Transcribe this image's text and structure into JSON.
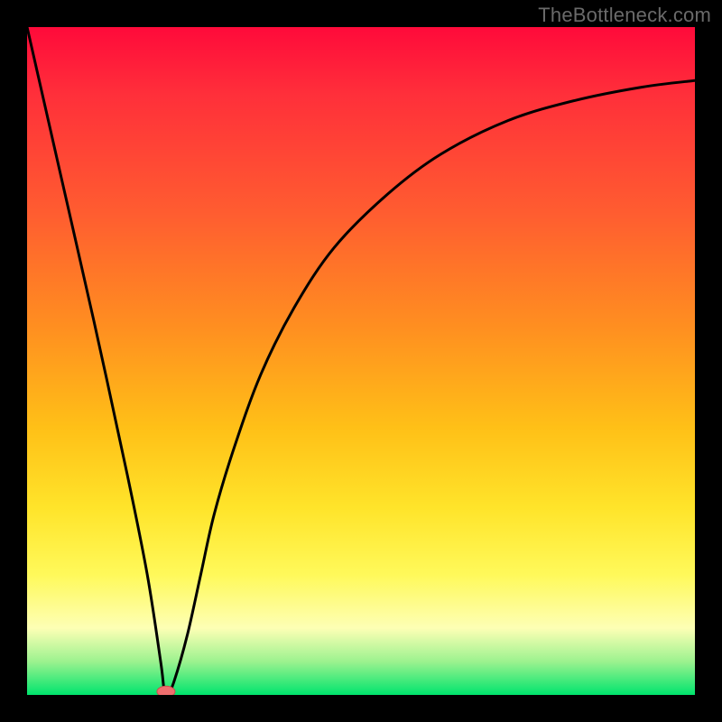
{
  "watermark": "TheBottleneck.com",
  "chart_data": {
    "type": "line",
    "title": "",
    "xlabel": "",
    "ylabel": "",
    "xlim": [
      0,
      100
    ],
    "ylim": [
      0,
      100
    ],
    "grid": false,
    "legend": false,
    "series": [
      {
        "name": "bottleneck-curve",
        "x": [
          0,
          5,
          10,
          15,
          18,
          20,
          20.5,
          21,
          22,
          24,
          26,
          28,
          31,
          35,
          40,
          46,
          54,
          62,
          72,
          82,
          92,
          100
        ],
        "values": [
          100,
          78,
          56,
          33,
          18,
          5,
          1,
          0,
          2,
          9,
          18,
          27,
          37,
          48,
          58,
          67,
          75,
          81,
          86,
          89,
          91,
          92
        ]
      }
    ],
    "markers": [
      {
        "name": "optimal-point",
        "x": 20.8,
        "y": 0.5
      }
    ],
    "background_gradient": {
      "top_color": "#ff0a3a",
      "bottom_color": "#00e46d",
      "meaning": "red = high bottleneck, green = no bottleneck"
    }
  }
}
